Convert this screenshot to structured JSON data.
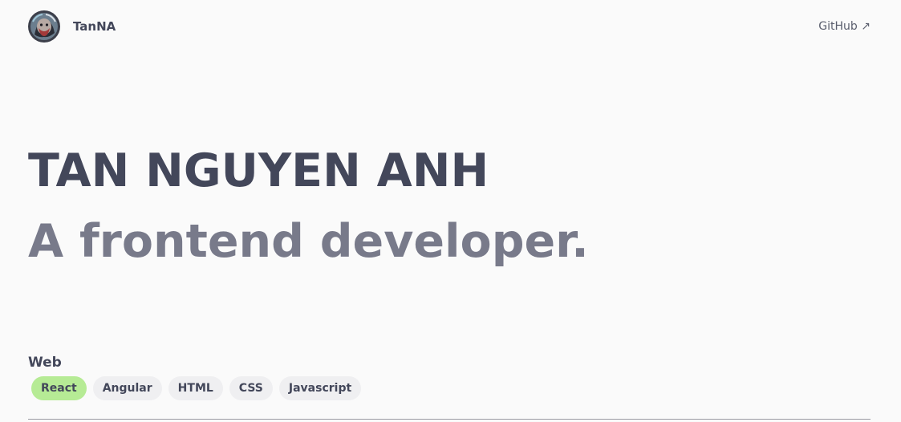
{
  "header": {
    "brand_name": "TanNA",
    "github_label": "GitHub ↗"
  },
  "hero": {
    "name": "TAN NGUYEN ANH",
    "role": "A frontend developer."
  },
  "skills": {
    "title": "Web",
    "tags": [
      "React",
      "Angular",
      "HTML",
      "CSS",
      "Javascript"
    ],
    "active_tag": "React"
  },
  "colors": {
    "background": "#fafafa",
    "text_primary": "#43475a",
    "text_secondary": "#787a8a",
    "tag_background": "#efeff1",
    "tag_active": "#b6eb95"
  }
}
